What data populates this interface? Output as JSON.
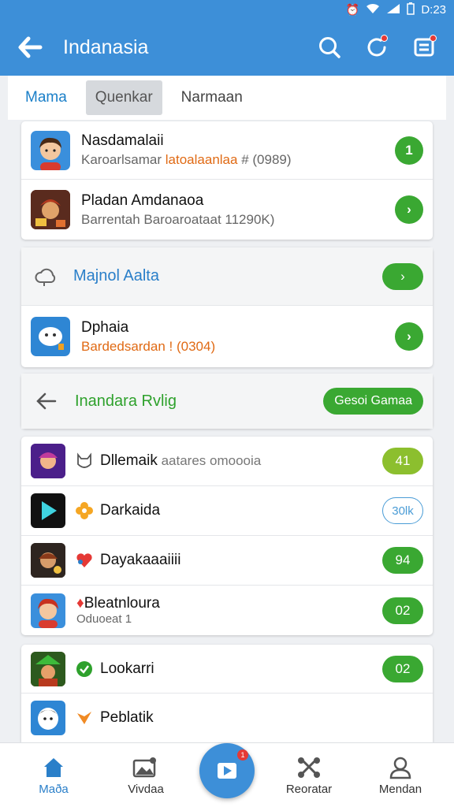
{
  "status": {
    "time": "D:23"
  },
  "appbar": {
    "title": "Indanasia"
  },
  "tabs": [
    {
      "label": "Mama"
    },
    {
      "label": "Quenkar"
    },
    {
      "label": "Narmaan"
    }
  ],
  "card1": {
    "rows": [
      {
        "title": "Nasdamalaii",
        "sub_a": "Karoarlsamar ",
        "sub_b": "latoalaanlaa",
        "sub_c": " # (0989)",
        "badge": "1"
      },
      {
        "title": "Pladan Amdanaoa",
        "sub": "Barrentah Baroaroataat 11290K)",
        "badge": "›"
      }
    ]
  },
  "card2": {
    "header": {
      "title": "Majnol Aalta",
      "badge": "›"
    },
    "rows": [
      {
        "title": "Dphaia",
        "sub": "Bardedsardan ! (0304)",
        "badge": "›"
      }
    ]
  },
  "card3": {
    "header": {
      "title": "Inandara Rvlig",
      "button": "Gesoi Gamaa"
    },
    "rows": [
      {
        "title": "Dllemaik",
        "sub": " aatares omoooia",
        "badge": "41"
      },
      {
        "title": "Darkaida",
        "badge": "30lk"
      },
      {
        "title": "Dayakaaaiiii",
        "badge": "94"
      },
      {
        "title": "Bleatnloura",
        "sub": "Oduoeat 1",
        "badge": "02"
      }
    ]
  },
  "card4": {
    "rows": [
      {
        "title": "Lookarri",
        "badge": "02"
      },
      {
        "title": "Peblatik"
      }
    ]
  },
  "nav": [
    {
      "label": "Maða"
    },
    {
      "label": "Vivdaa"
    },
    {
      "label": "",
      "badge": "1"
    },
    {
      "label": "Reoratar"
    },
    {
      "label": "Mendan"
    }
  ],
  "colors": {
    "primary": "#3d8fd8",
    "green": "#3aa832",
    "orange": "#e06a14"
  }
}
